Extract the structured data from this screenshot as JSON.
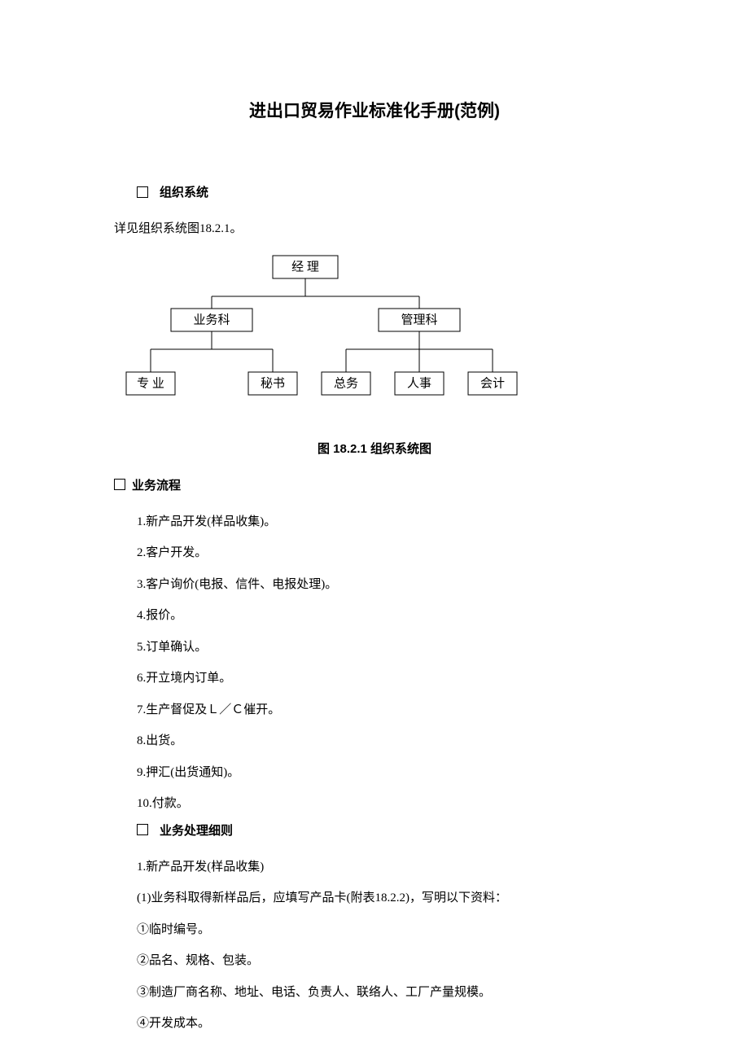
{
  "title": "进出口贸易作业标准化手册(范例)",
  "section1": {
    "heading": "组织系统",
    "intro": "详见组织系统图18.2.1。"
  },
  "chart_data": {
    "type": "tree",
    "title": "图 18.2.1   组织系统图",
    "root": {
      "label": "经 理"
    },
    "level2": [
      {
        "label": "业务科"
      },
      {
        "label": "管理科"
      }
    ],
    "level3_left": [
      {
        "label": "专 业"
      },
      {
        "label": "秘书"
      }
    ],
    "level3_right": [
      {
        "label": "总务"
      },
      {
        "label": "人事"
      },
      {
        "label": "会计"
      }
    ]
  },
  "section2": {
    "heading": "业务流程",
    "items": [
      "1.新产品开发(样品收集)。",
      "2.客户开发。",
      "3.客户询价(电报、信件、电报处理)。",
      "4.报价。",
      "5.订单确认。",
      "6.开立境内订单。",
      "7.生产督促及Ｌ／Ｃ催开。",
      "8.出货。",
      "9.押汇(出货通知)。",
      "10.付款。"
    ]
  },
  "section3": {
    "heading": "业务处理细则",
    "items": [
      "1.新产品开发(样品收集)",
      "(1)业务科取得新样品后，应填写产品卡(附表18.2.2)，写明以下资料：",
      "①临时编号。",
      "②品名、规格、包装。",
      "③制造厂商名称、地址、电话、负责人、联络人、工厂产量规模。",
      "④开发成本。"
    ]
  }
}
